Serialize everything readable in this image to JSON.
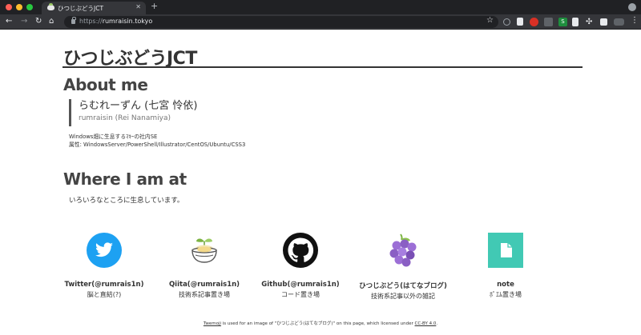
{
  "browser": {
    "tab_title": "ひつじぶどうJCT",
    "url_proto": "https://",
    "url_host": "rumraisin.tokyo"
  },
  "site": {
    "title": "ひつじぶどうJCT"
  },
  "about": {
    "heading": "About me",
    "name": "らむれーずん (七宮 怜依)",
    "name_en": "rumraisin (Rei Nanamiya)",
    "bio_line1": "Windows畑に生息するﾏｷｰの社内SE",
    "bio_line2": "属性: WindowsServer/PowerShell/Illustrator/CentOS/Ubuntu/CSS3"
  },
  "where": {
    "heading": "Where I am at",
    "text": "いろいろなところに生息しています。"
  },
  "links": [
    {
      "label": "Twitter(@rumrais1n)",
      "desc": "脳と直結(?)",
      "icon": "twitter-bird-icon",
      "color": "#1da1f2"
    },
    {
      "label": "Qiita(@rumrais1n)",
      "desc": "技術系記事置き場",
      "icon": "qiita-bowl-icon",
      "color": "#9ccc65"
    },
    {
      "label": "Github(@rumrais1n)",
      "desc": "コード置き場",
      "icon": "github-octocat-icon",
      "color": "#111111"
    },
    {
      "label": "ひつじぶどう(はてなブログ)",
      "desc": "技術系記事以外の雑記",
      "icon": "grapes-icon",
      "color": "#8a5fc4"
    },
    {
      "label": "note",
      "desc": "ﾎﾟｴﾑ置き場",
      "icon": "note-icon",
      "color": "#41c9b4"
    }
  ],
  "footer": {
    "twemoji": "Twemoji",
    "middle": " is used for an image of \"ひつじぶどう(はてなブログ)\" on this page, which licensed under ",
    "license": "CC-BY 4.0",
    "end": "."
  }
}
